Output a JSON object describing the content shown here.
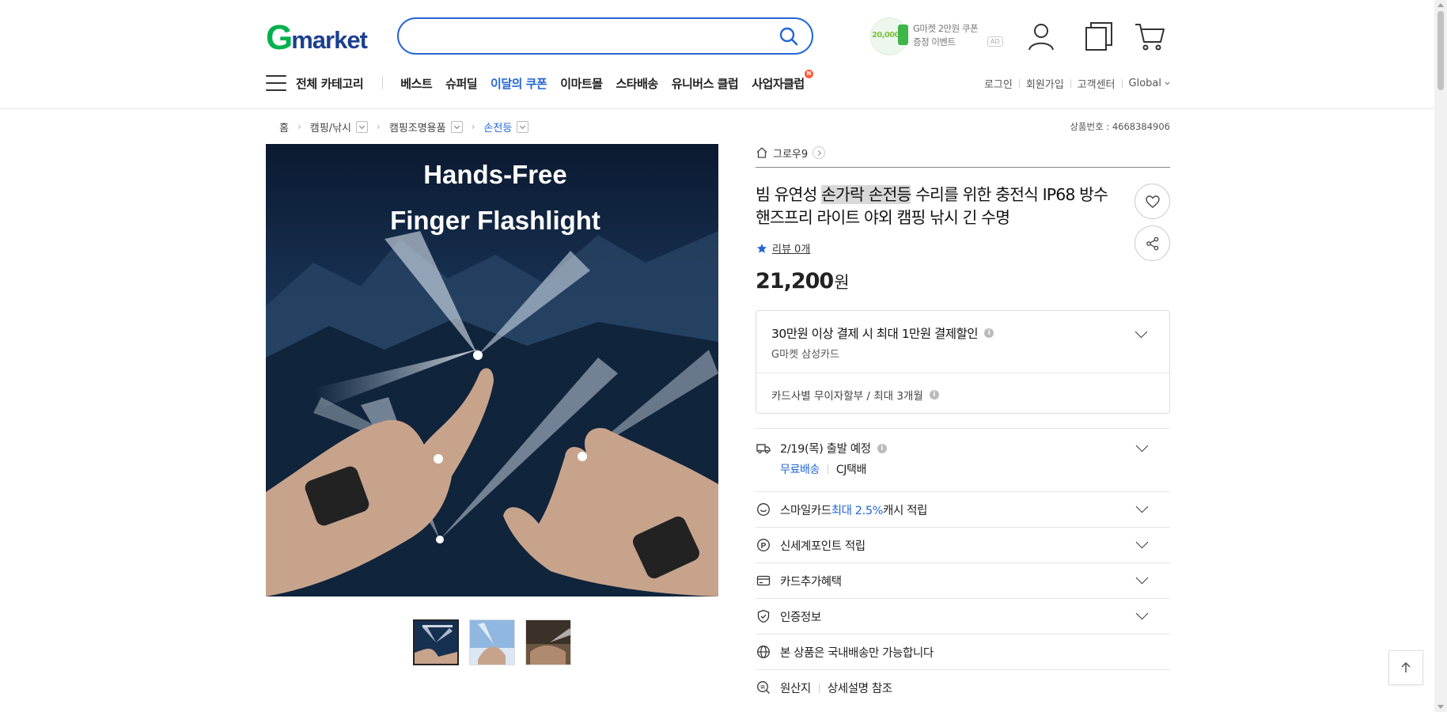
{
  "header": {
    "logo_g": "G",
    "logo_rest": "market",
    "search_value": "",
    "promo_amount": "20,000",
    "promo_line1": "G마켓 2만원 쿠폰",
    "promo_line2": "증정 이벤트",
    "ad": "AD"
  },
  "nav": {
    "all_categories": "전체 카테고리",
    "links": [
      "베스트",
      "슈퍼딜",
      "이달의 쿠폰",
      "이마트몰",
      "스타배송",
      "유니버스 클럽",
      "사업자클럽"
    ],
    "new_badge": "N",
    "util": [
      "로그인",
      "회원가입",
      "고객센터",
      "Global"
    ]
  },
  "breadcrumb": {
    "home": "홈",
    "items": [
      "캠핑/낚시",
      "캠핑조명용품",
      "손전등"
    ]
  },
  "product_no": "상품번호 : 4668384906",
  "gallery": {
    "line1": "Hands-Free",
    "line2": "Finger Flashlight"
  },
  "product": {
    "seller": "그로우9",
    "title_before": "빔 유연성 ",
    "title_highlight": "손가락 손전등",
    "title_after": " 수리를 위한 충전식 IP68 방수 핸즈프리 라이트 야외 캠핑 낚시 긴 수명",
    "review": "리뷰 0개",
    "price": "21,200",
    "currency": "원"
  },
  "benefit": {
    "main": "30만원 이상 결제 시 최대 1만원 결제할인",
    "sub": "G마켓 삼성카드",
    "installment": "카드사별 무이자할부 / 최대 3개월"
  },
  "delivery": {
    "date": "2/19(목) 출발 예정",
    "free": "무료배송",
    "courier": "CJ택배"
  },
  "rows": {
    "smile_prefix": "스마일카드 ",
    "smile_rate": "최대 2.5%",
    "smile_suffix": " 캐시 적립",
    "shinsegae": "신세계포인트 적립",
    "card_benefit": "카드추가혜택",
    "certification": "인증정보",
    "domestic": "본 상품은 국내배송만 가능합니다",
    "origin": "원산지",
    "origin_value": "상세설명 참조"
  },
  "colors": {
    "brand_green": "#00b14f",
    "brand_blue": "#1c3f8f",
    "accent_blue": "#2266d7"
  }
}
